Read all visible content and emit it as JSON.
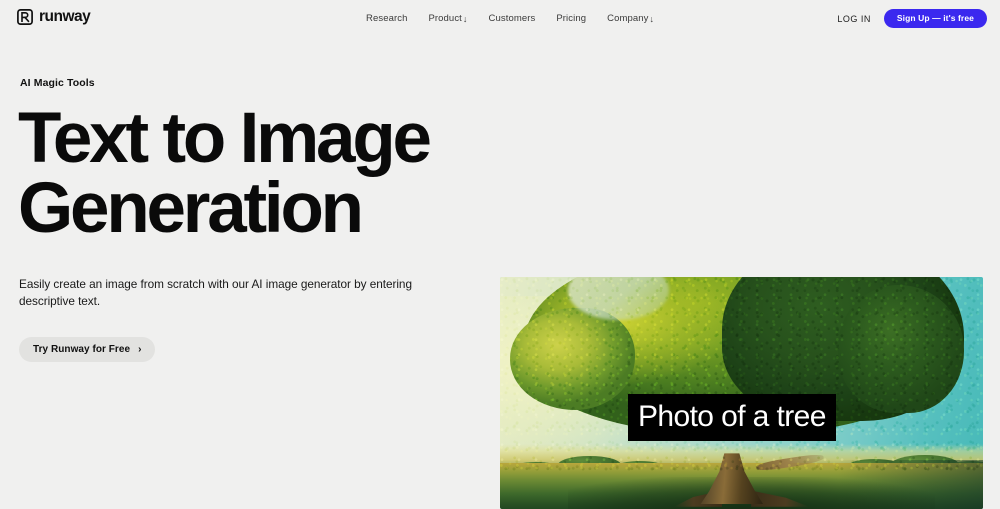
{
  "header": {
    "brand": {
      "name": "runway",
      "logo_icon": "runway-logo-mark"
    },
    "nav": [
      {
        "label": "Research",
        "caret": "",
        "has_dropdown": false
      },
      {
        "label": "Product",
        "caret": "↓",
        "has_dropdown": true
      },
      {
        "label": "Customers",
        "caret": "",
        "has_dropdown": false
      },
      {
        "label": "Pricing",
        "caret": "",
        "has_dropdown": false
      },
      {
        "label": "Company",
        "caret": "↓",
        "has_dropdown": true
      }
    ],
    "login_label": "LOG IN",
    "signup_label": "Sign Up — it's free",
    "signup_color": "#3b28ef"
  },
  "hero": {
    "eyebrow": "AI Magic Tools",
    "title_line1": "Text to Image",
    "title_line2": "Generation",
    "description": "Easily create an image from scratch with our AI image generator by entering descriptive text.",
    "cta_label": "Try Runway for Free",
    "cta_arrow": "›",
    "cta_bg": "#e2e2e0"
  },
  "media": {
    "caption": "Photo of a tree",
    "caption_bg": "#000000",
    "caption_color": "#ffffff",
    "alt": "AI generated photo of a large green tree in a field under a teal sky",
    "sky_left_color": "#e6ecc8",
    "sky_right_color": "#46b9b8",
    "foliage_highlight": "#cdd24a",
    "foliage_shadow": "#1f4518",
    "ground_color": "#6c8a34"
  },
  "page": {
    "background": "#f0f0ef"
  }
}
